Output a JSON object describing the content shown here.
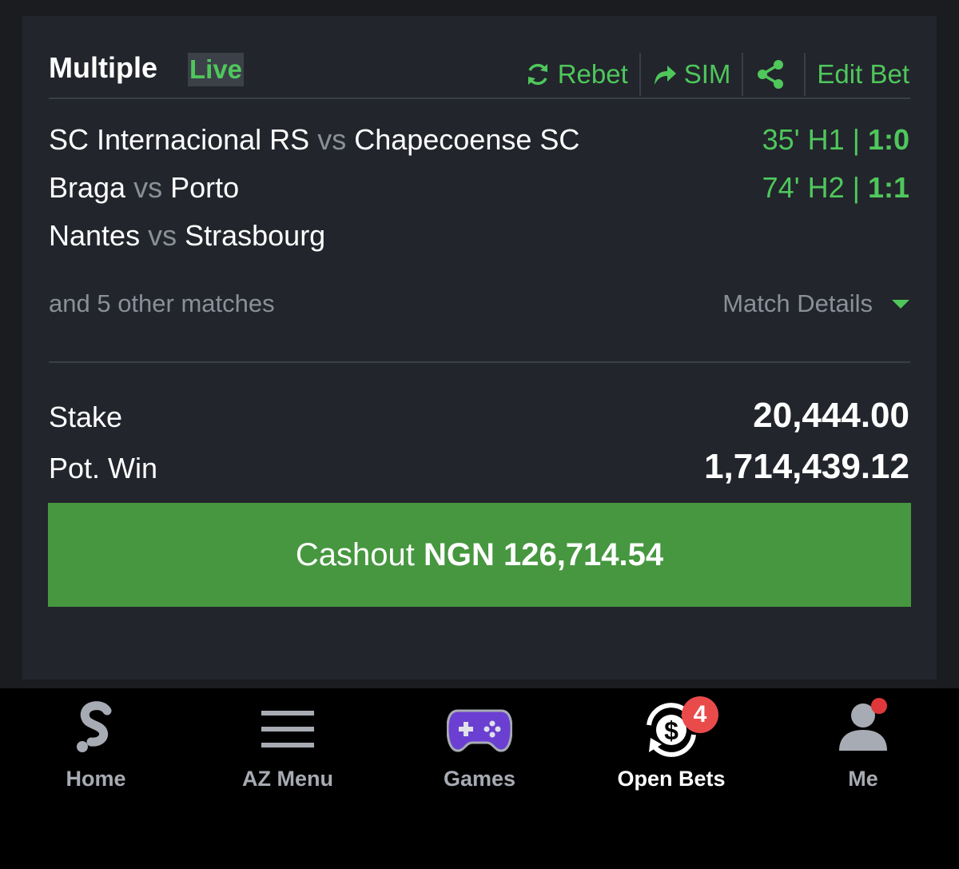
{
  "bet": {
    "title": "Multiple",
    "status": "Live",
    "actions": {
      "rebet": "Rebet",
      "sim": "SIM",
      "edit": "Edit Bet"
    },
    "matches": [
      {
        "home": "SC Internacional RS",
        "vs": "vs",
        "away": "Chapecoense SC",
        "time": "35' H1 |",
        "score": "1:0"
      },
      {
        "home": "Braga",
        "vs": "vs",
        "away": "Porto",
        "time": "74' H2 |",
        "score": "1:1"
      },
      {
        "home": "Nantes",
        "vs": "vs",
        "away": "Strasbourg",
        "time": "",
        "score": ""
      }
    ],
    "more_matches": "and 5 other matches",
    "match_details": "Match Details",
    "stake_label": "Stake",
    "stake_value": "20,444.00",
    "potwin_label": "Pot. Win",
    "potwin_value": "1,714,439.12",
    "cashout_prefix": "Cashout",
    "cashout_amount": "NGN 126,714.54"
  },
  "tabs": [
    {
      "label": "Home",
      "icon": "sporty-logo-icon"
    },
    {
      "label": "AZ Menu",
      "icon": "menu-icon"
    },
    {
      "label": "Games",
      "icon": "gamepad-icon"
    },
    {
      "label": "Open Bets",
      "icon": "open-bets-icon",
      "badge": "4"
    },
    {
      "label": "Me",
      "icon": "user-icon"
    }
  ],
  "colors": {
    "accent": "#4fc75b",
    "cashout": "#46973f",
    "badge": "#e94b4b"
  }
}
